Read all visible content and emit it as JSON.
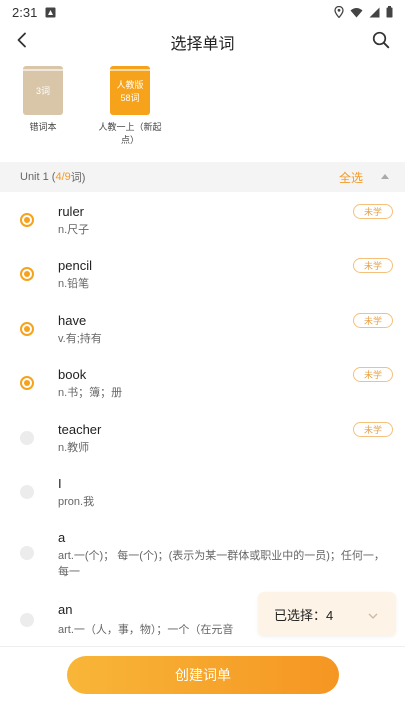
{
  "status_bar": {
    "time": "2:31"
  },
  "header": {
    "title": "选择单词"
  },
  "books": [
    {
      "cover_text": "3词",
      "cover_sub": "",
      "label": "错词本",
      "selected": false
    },
    {
      "cover_text": "人教版",
      "cover_sub": "58词",
      "label": "人教一上（新起点）",
      "selected": true
    }
  ],
  "unit": {
    "name": "Unit 1 (",
    "count": "4/9",
    "suffix": "词)",
    "select_all": "全选"
  },
  "words": [
    {
      "word": "ruler",
      "meaning": "n.尺子",
      "tag": "未学",
      "checked": true
    },
    {
      "word": "pencil",
      "meaning": "n.铅笔",
      "tag": "未学",
      "checked": true
    },
    {
      "word": "have",
      "meaning": "v.有;持有",
      "tag": "未学",
      "checked": true
    },
    {
      "word": "book",
      "meaning": "n.书；簿；册",
      "tag": "未学",
      "checked": true
    },
    {
      "word": "teacher",
      "meaning": "n.教师",
      "tag": "未学",
      "checked": false
    },
    {
      "word": "I",
      "meaning": "pron.我",
      "tag": "",
      "checked": false
    },
    {
      "word": "a",
      "meaning": "art.一(个)；  每一(个)；(表示为某一群体或职业中的一员)；任何一，每一",
      "tag": "",
      "checked": false
    },
    {
      "word": "an",
      "meaning": "art.一（人，事，物）；一个（在元音",
      "tag": "",
      "checked": false
    }
  ],
  "selected_popup": {
    "text": "已选择：4"
  },
  "create_button": {
    "label": "创建词单"
  },
  "colors": {
    "accent": "#f7a21b",
    "tag_border": "#f5c07a",
    "popup_bg": "#fdf3e6"
  }
}
